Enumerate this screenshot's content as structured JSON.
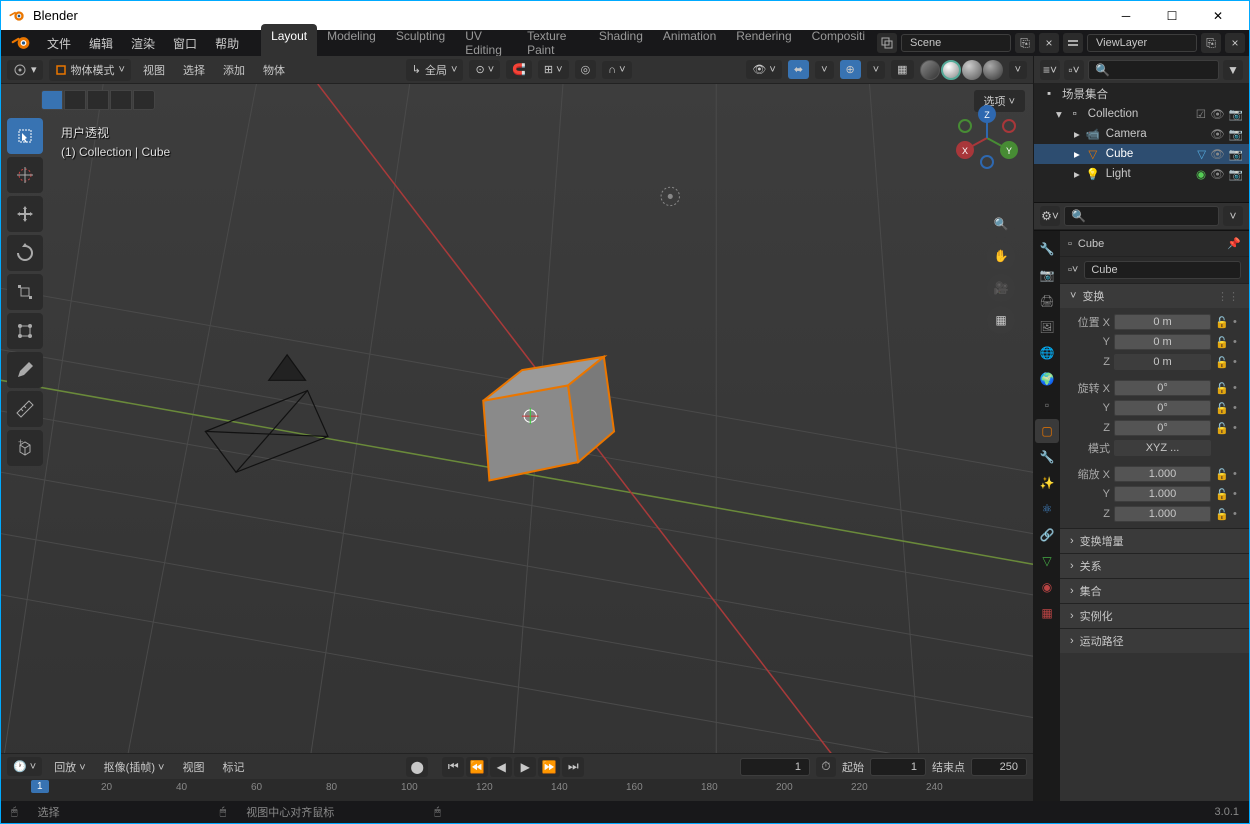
{
  "window_title": "Blender",
  "version_label": "3.0.1",
  "menu": [
    "文件",
    "编辑",
    "渲染",
    "窗口",
    "帮助"
  ],
  "workspaces": [
    "Layout",
    "Modeling",
    "Sculpting",
    "UV Editing",
    "Texture Paint",
    "Shading",
    "Animation",
    "Rendering",
    "Compositi"
  ],
  "active_ws": "Layout",
  "scene_label": "Scene",
  "viewlayer_label": "ViewLayer",
  "viewport": {
    "mode_label": "物体模式",
    "menus": [
      "视图",
      "选择",
      "添加",
      "物体"
    ],
    "orient_label": "全局",
    "options_label": "选项",
    "overlay_line1": "用户透视",
    "overlay_line2": "(1) Collection | Cube"
  },
  "outliner": {
    "root": "场景集合",
    "collection": "Collection",
    "items": [
      "Camera",
      "Cube",
      "Light"
    ]
  },
  "props": {
    "crumb_obj": "Cube",
    "obj_name": "Cube",
    "panel_transform": "变换",
    "loc_label": "位置",
    "rot_label": "旋转",
    "scale_label": "缩放",
    "mode_label": "模式",
    "xyz_label": "XYZ ...",
    "axes": [
      "X",
      "Y",
      "Z"
    ],
    "loc": [
      "0 m",
      "0 m",
      "0 m"
    ],
    "rot": [
      "0°",
      "0°",
      "0°"
    ],
    "scale": [
      "1.000",
      "1.000",
      "1.000"
    ],
    "panels_collapsed": [
      "变换增量",
      "关系",
      "集合",
      "实例化",
      "运动路径"
    ]
  },
  "timeline": {
    "menus": [
      "回放",
      "抠像(插帧)",
      "视图",
      "标记"
    ],
    "current": "1",
    "start_label": "起始",
    "start": "1",
    "end_label": "结束点",
    "end": "250",
    "ticks": [
      "20",
      "40",
      "60",
      "80",
      "100",
      "120",
      "140",
      "160",
      "180",
      "200",
      "220",
      "240"
    ]
  },
  "status": {
    "select": "选择",
    "action": "视图中心对齐鼠标"
  }
}
